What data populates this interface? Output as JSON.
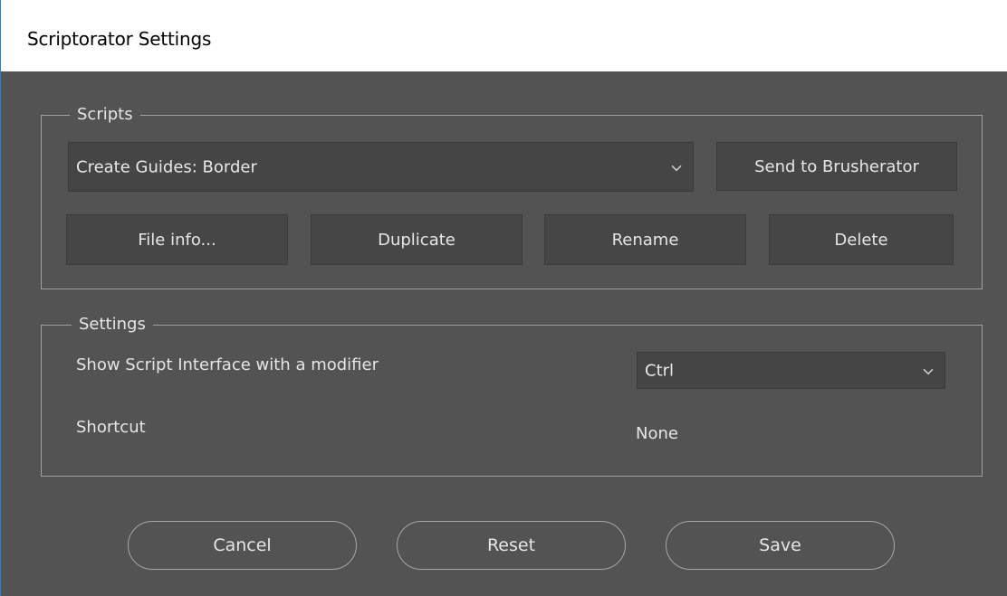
{
  "window": {
    "title": "Scriptorator Settings"
  },
  "scripts": {
    "legend": "Scripts",
    "selected_script": "Create Guides: Border",
    "send_button": "Send to Brusherator",
    "file_info_button": "File info...",
    "duplicate_button": "Duplicate",
    "rename_button": "Rename",
    "delete_button": "Delete"
  },
  "settings": {
    "legend": "Settings",
    "modifier_label": "Show Script Interface with a modifier",
    "modifier_value": "Ctrl",
    "shortcut_label": "Shortcut",
    "shortcut_value": "None"
  },
  "footer": {
    "cancel_button": "Cancel",
    "reset_button": "Reset",
    "save_button": "Save"
  },
  "colors": {
    "panel_background": "#535353",
    "control_background": "#464646",
    "text": "#e6e6e6",
    "window_border": "#2b7bd6"
  }
}
